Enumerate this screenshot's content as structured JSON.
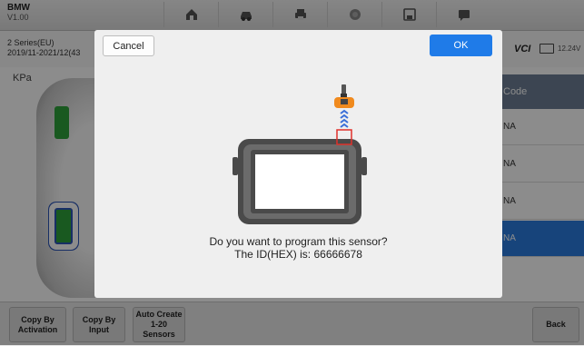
{
  "app": {
    "title": "BMW",
    "version": "V1.00"
  },
  "toolbar": {
    "icons": [
      "home-icon",
      "vehicle-icon",
      "print-icon",
      "help-icon",
      "save-icon",
      "message-icon"
    ]
  },
  "vehicle": {
    "model": "2 Series(EU)",
    "years": "2019/11-2021/12(43",
    "vci": "VCI",
    "voltage": "12.24V"
  },
  "pressure_unit": "KPa",
  "sensor_table": {
    "header": "Code",
    "rows": [
      "NA",
      "NA",
      "NA",
      "NA"
    ],
    "selected_index": 3
  },
  "bottom": {
    "copy_activation": "Copy By Activation",
    "copy_input": "Copy By Input",
    "auto_create": "Auto Create 1-20 Sensors",
    "back": "Back"
  },
  "dialog": {
    "cancel": "Cancel",
    "ok": "OK",
    "question": "Do you want to program this sensor?",
    "id_line": "The ID(HEX) is: 66666678"
  },
  "colors": {
    "accent": "#1f7be8",
    "tire_ok": "#2fa33b",
    "highlight": "#e0312b"
  }
}
